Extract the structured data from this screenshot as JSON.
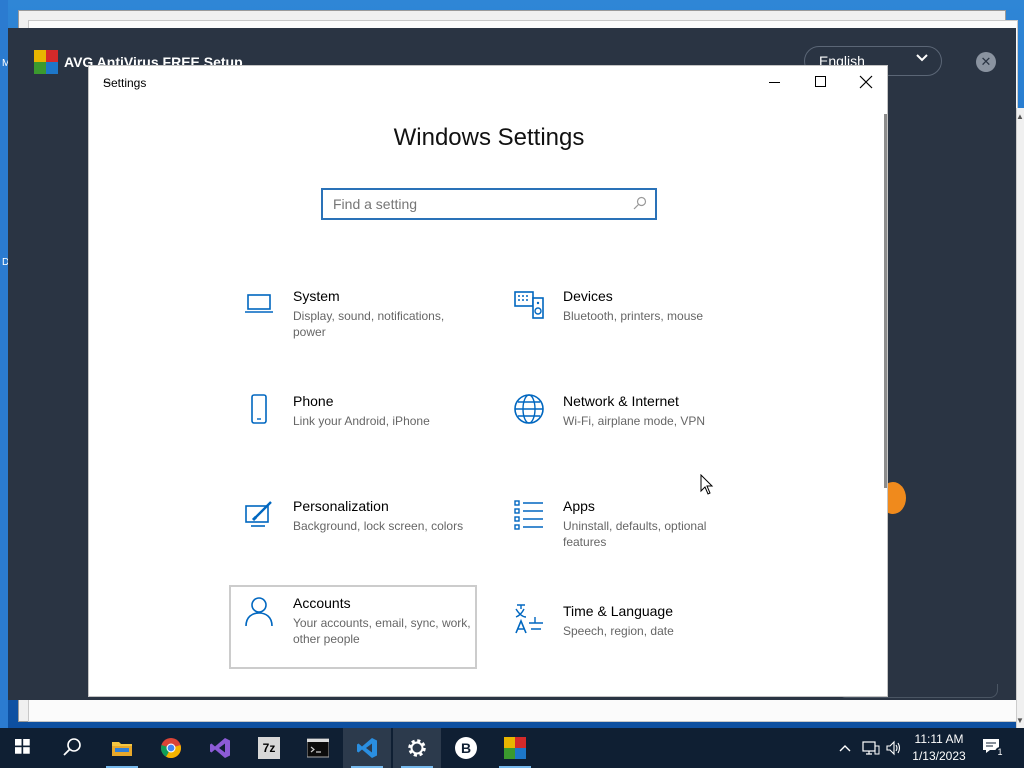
{
  "desktop": {
    "left_labels": [
      "M",
      "D"
    ]
  },
  "avg_window": {
    "title": "AVG AntiVirus FREE Setup",
    "language": "English",
    "close_glyph": "✕",
    "logo_colors": [
      "#e8b500",
      "#d42a2a",
      "#3b9a2e",
      "#1d77c9"
    ]
  },
  "settings_window": {
    "title": "Settings",
    "page_title": "Windows Settings",
    "search": {
      "placeholder": "Find a setting",
      "value": ""
    },
    "tiles": [
      {
        "name": "System",
        "desc": "Display, sound, notifications, power",
        "icon": "laptop-icon"
      },
      {
        "name": "Devices",
        "desc": "Bluetooth, printers, mouse",
        "icon": "keyboard-speaker-icon"
      },
      {
        "name": "Phone",
        "desc": "Link your Android, iPhone",
        "icon": "phone-icon"
      },
      {
        "name": "Network & Internet",
        "desc": "Wi-Fi, airplane mode, VPN",
        "icon": "globe-icon"
      },
      {
        "name": "Personalization",
        "desc": "Background, lock screen, colors",
        "icon": "paint-icon"
      },
      {
        "name": "Apps",
        "desc": "Uninstall, defaults, optional features",
        "icon": "apps-list-icon"
      },
      {
        "name": "Accounts",
        "desc": "Your accounts, email, sync, work, other people",
        "icon": "person-icon"
      },
      {
        "name": "Time & Language",
        "desc": "Speech, region, date",
        "icon": "time-language-icon"
      }
    ],
    "accent": "#0067c0"
  },
  "taskbar": {
    "apps": [
      {
        "name": "start",
        "icon": "windows-logo-icon"
      },
      {
        "name": "search",
        "icon": "search-icon"
      },
      {
        "name": "file-explorer",
        "icon": "folder-icon"
      },
      {
        "name": "chrome",
        "icon": "chrome-icon"
      },
      {
        "name": "visual-studio",
        "icon": "visual-studio-icon"
      },
      {
        "name": "7zip",
        "icon": "7zip-icon"
      },
      {
        "name": "terminal",
        "icon": "terminal-icon"
      },
      {
        "name": "vscode",
        "icon": "vscode-icon"
      },
      {
        "name": "settings",
        "icon": "gear-icon"
      },
      {
        "name": "b-app",
        "icon": "b-circle-icon"
      },
      {
        "name": "avg",
        "icon": "avg-icon"
      }
    ],
    "seven_zip_label": "7z",
    "b_label": "B",
    "time": "11:11 AM",
    "date": "1/13/2023",
    "notification_count": "1"
  }
}
